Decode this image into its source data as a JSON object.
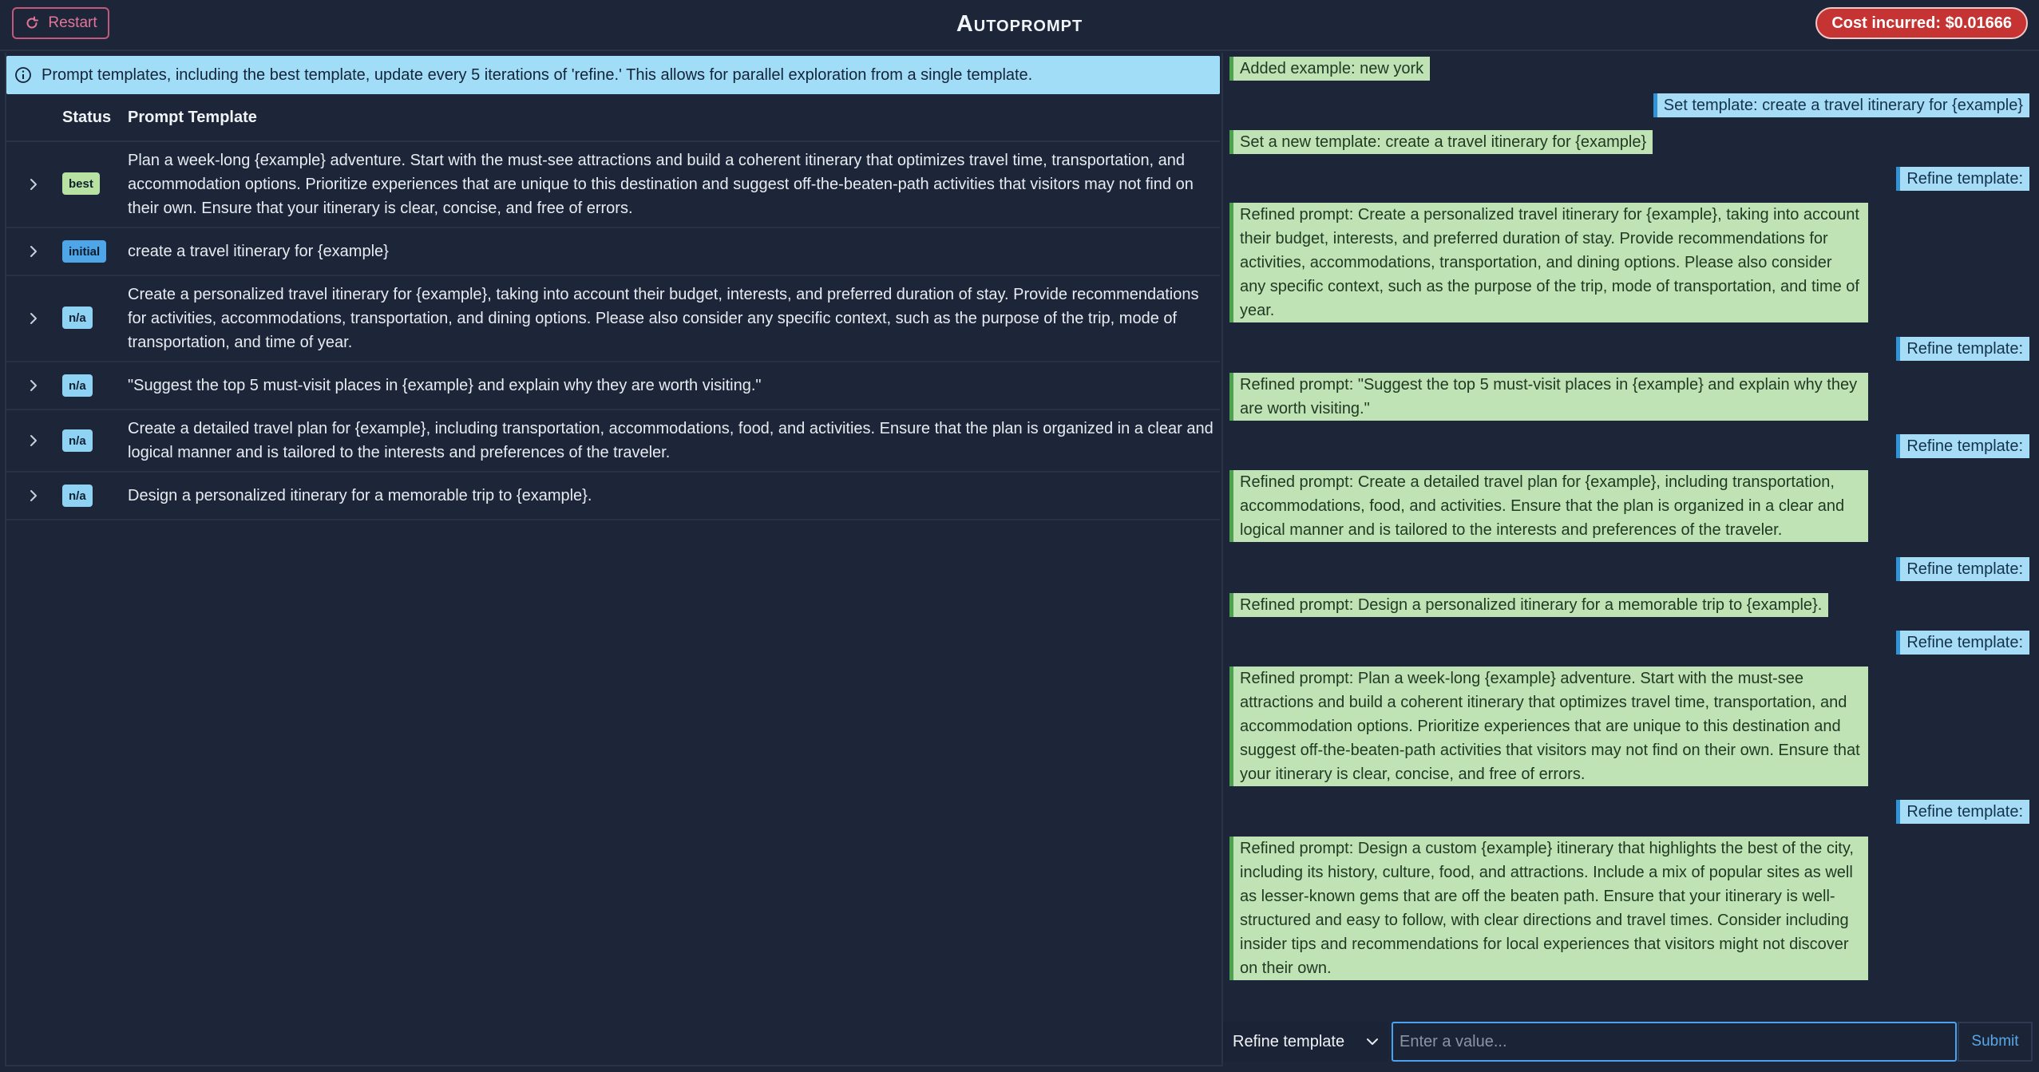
{
  "header": {
    "restart_label": "Restart",
    "title": "Autoprompt",
    "cost_label": "Cost incurred: $0.01666"
  },
  "banner": {
    "text": "Prompt templates, including the best template, update every 5 iterations of 'refine.' This allows for parallel exploration from a single template."
  },
  "table": {
    "headers": {
      "status": "Status",
      "template": "Prompt Template"
    },
    "rows": [
      {
        "status": "best",
        "text": "Plan a week-long {example} adventure. Start with the must-see attractions and build a coherent itinerary that optimizes travel time, transportation, and accommodation options. Prioritize experiences that are unique to this destination and suggest off-the-beaten-path activities that visitors may not find on their own. Ensure that your itinerary is clear, concise, and free of errors."
      },
      {
        "status": "initial",
        "text": "create a travel itinerary for {example}"
      },
      {
        "status": "n/a",
        "text": "Create a personalized travel itinerary for {example}, taking into account their budget, interests, and preferred duration of stay. Provide recommendations for activities, accommodations, transportation, and dining options. Please also consider any specific context, such as the purpose of the trip, mode of transportation, and time of year."
      },
      {
        "status": "n/a",
        "text": "\"Suggest the top 5 must-visit places in {example} and explain why they are worth visiting.\""
      },
      {
        "status": "n/a",
        "text": "Create a detailed travel plan for {example}, including transportation, accommodations, food, and activities. Ensure that the plan is organized in a clear and logical manner and is tailored to the interests and preferences of the traveler."
      },
      {
        "status": "n/a",
        "text": "Design a personalized itinerary for a memorable trip to {example}."
      }
    ]
  },
  "chat": {
    "messages": [
      {
        "role": "system",
        "text": "Added example: new york"
      },
      {
        "role": "user",
        "text": "Set template: create a travel itinerary for {example}"
      },
      {
        "role": "system",
        "text": "Set a new template: create a travel itinerary for {example}"
      },
      {
        "role": "user",
        "text": "Refine template:"
      },
      {
        "role": "system",
        "text": "Refined prompt: Create a personalized travel itinerary for {example}, taking into account their budget, interests, and preferred duration of stay. Provide recommendations for activities, accommodations, transportation, and dining options. Please also consider any specific context, such as the purpose of the trip, mode of transportation, and time of year."
      },
      {
        "role": "user",
        "text": "Refine template:"
      },
      {
        "role": "system",
        "text": "Refined prompt: \"Suggest the top 5 must-visit places in {example} and explain why they are worth visiting.\""
      },
      {
        "role": "user",
        "text": "Refine template:"
      },
      {
        "role": "system",
        "text": "Refined prompt: Create a detailed travel plan for {example}, including transportation, accommodations, food, and activities. Ensure that the plan is organized in a clear and logical manner and is tailored to the interests and preferences of the traveler."
      },
      {
        "role": "user",
        "text": "Refine template:"
      },
      {
        "role": "system",
        "text": "Refined prompt: Design a personalized itinerary for a memorable trip to {example}."
      },
      {
        "role": "user",
        "text": "Refine template:"
      },
      {
        "role": "system",
        "text": "Refined prompt: Plan a week-long {example} adventure. Start with the must-see attractions and build a coherent itinerary that optimizes travel time, transportation, and accommodation options. Prioritize experiences that are unique to this destination and suggest off-the-beaten-path activities that visitors may not find on their own. Ensure that your itinerary is clear, concise, and free of errors."
      },
      {
        "role": "user",
        "text": "Refine template:"
      },
      {
        "role": "system",
        "text": "Refined prompt: Design a custom {example} itinerary that highlights the best of the city, including its history, culture, food, and attractions. Include a mix of popular sites as well as lesser-known gems that are off the beaten path. Ensure that your itinerary is well-structured and easy to follow, with clear directions and travel times. Consider including insider tips and recommendations for local experiences that visitors might not discover on their own."
      }
    ]
  },
  "footer": {
    "select_value": "Refine template",
    "input_placeholder": "Enter a value...",
    "submit_label": "Submit"
  },
  "colors": {
    "background": "#1c2638",
    "banner": "#a2ddf7",
    "cost_badge": "#c53333",
    "restart": "#e5749a",
    "system_message": "#bfe3b5",
    "user_message": "#a6dcf6",
    "badge_best": "#b7e2a1",
    "badge_initial": "#4ea6e8",
    "badge_na": "#8fd3f4"
  }
}
